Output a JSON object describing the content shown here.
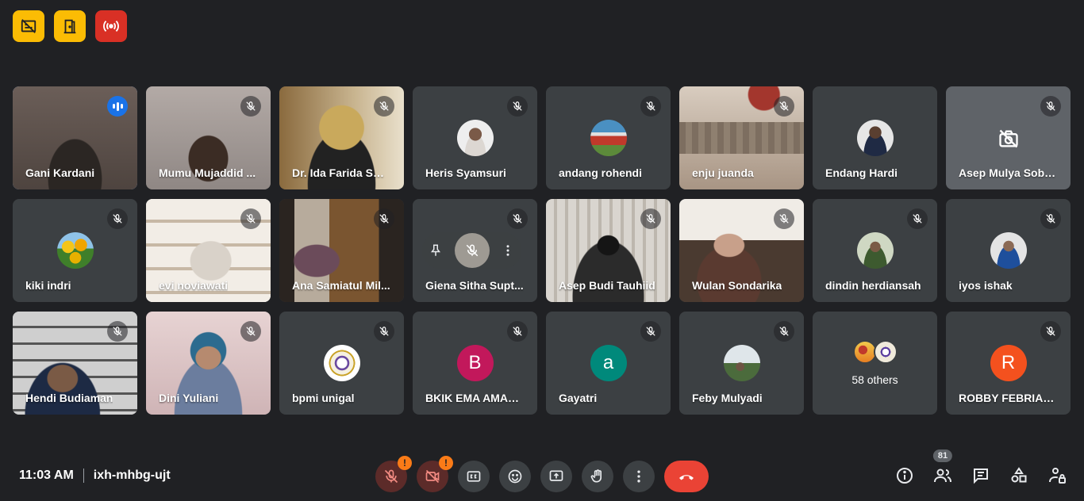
{
  "top_icons": [
    {
      "icon": "captions-off-icon",
      "color": "#fbbc04"
    },
    {
      "icon": "exit-door-icon",
      "color": "#fbbc04"
    },
    {
      "icon": "broadcast-icon",
      "color": "#d93025"
    }
  ],
  "participants": [
    {
      "name": "Gani Kardani",
      "type": "video",
      "speaking": true
    },
    {
      "name": "Mumu Mujaddid ...",
      "type": "video"
    },
    {
      "name": "Dr. Ida Farida SH....",
      "type": "video"
    },
    {
      "name": "Heris Syamsuri",
      "type": "avatar"
    },
    {
      "name": "andang rohendi",
      "type": "avatar"
    },
    {
      "name": "enju juanda",
      "type": "video"
    },
    {
      "name": "Endang Hardi",
      "type": "avatar"
    },
    {
      "name": "Asep Mulya Sobari",
      "type": "camera-off"
    },
    {
      "name": "kiki indri",
      "type": "avatar"
    },
    {
      "name": "evi noviawati",
      "type": "video"
    },
    {
      "name": "Ana Samiatul Mil...",
      "type": "video"
    },
    {
      "name": "Giena Sitha Supt...",
      "type": "pinned-overlay"
    },
    {
      "name": "Asep Budi Tauhiid",
      "type": "video"
    },
    {
      "name": "Wulan Sondarika",
      "type": "video"
    },
    {
      "name": "dindin herdiansah",
      "type": "avatar"
    },
    {
      "name": "iyos ishak",
      "type": "avatar"
    },
    {
      "name": "Hendi Budiaman",
      "type": "video"
    },
    {
      "name": "Dini Yuliani",
      "type": "video"
    },
    {
      "name": "bpmi unigal",
      "type": "avatar"
    },
    {
      "name": "BKIK EMA AMALIA",
      "type": "letter",
      "letter": "B",
      "color": "#c2185b"
    },
    {
      "name": "Gayatri",
      "type": "letter",
      "letter": "a",
      "color": "#00897b"
    },
    {
      "name": "Feby Mulyadi",
      "type": "avatar"
    },
    {
      "name": "58 others",
      "type": "others"
    },
    {
      "name": "ROBBY FEBRIAN ...",
      "type": "letter",
      "letter": "R",
      "color": "#f4511e"
    }
  ],
  "meeting": {
    "time": "11:03 AM",
    "code": "ixh-mhbg-ujt"
  },
  "controls": {
    "mic_warning": "!",
    "cam_warning": "!"
  },
  "people_count": "81",
  "colors": {
    "accent": "#8ab4f8",
    "end_call": "#ea4335",
    "background": "#202124"
  }
}
